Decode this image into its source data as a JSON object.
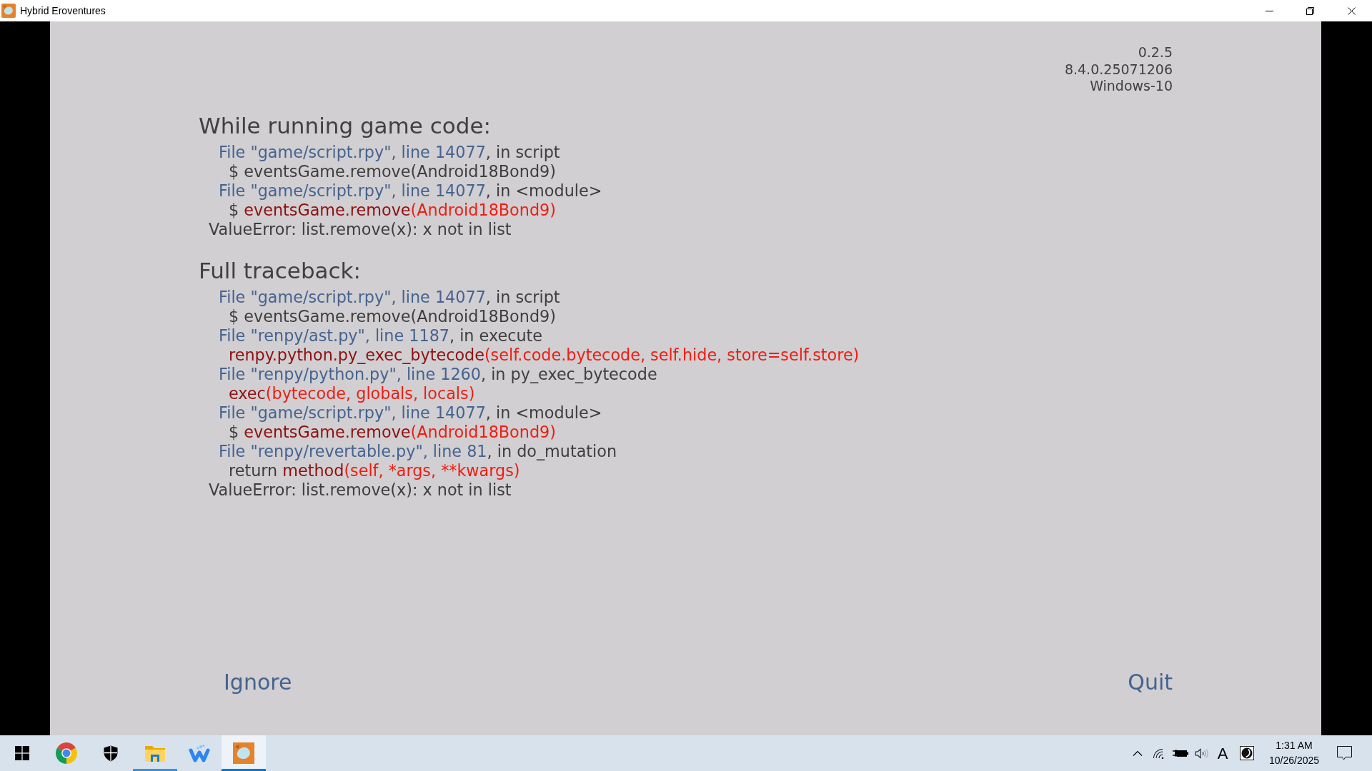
{
  "window": {
    "title": "Hybrid Eroventures"
  },
  "version_info": [
    "0.2.5",
    "8.4.0.25071206",
    "Windows-10"
  ],
  "sections": [
    {
      "heading": "While running game code:",
      "lines": [
        {
          "kind": "frame",
          "segments": [
            {
              "kind": "location",
              "text": "File \"game/script.rpy\", line 14077"
            },
            {
              "kind": "plain",
              "text": ", in script"
            }
          ]
        },
        {
          "kind": "source",
          "segments": [
            {
              "kind": "plain",
              "text": "$ eventsGame.remove(Android18Bond9)"
            }
          ]
        },
        {
          "kind": "frame",
          "segments": [
            {
              "kind": "location",
              "text": "File \"game/script.rpy\", line 14077"
            },
            {
              "kind": "plain",
              "text": ", in <module>"
            }
          ]
        },
        {
          "kind": "source",
          "segments": [
            {
              "kind": "plain",
              "text": "$ "
            },
            {
              "kind": "callee",
              "text": "eventsGame.remove"
            },
            {
              "kind": "arguments",
              "text": "(Android18Bond9)"
            }
          ]
        },
        {
          "kind": "exception",
          "segments": [
            {
              "kind": "plain",
              "text": "ValueError: list.remove(x): x not in list"
            }
          ]
        }
      ]
    },
    {
      "heading": "Full traceback:",
      "lines": [
        {
          "kind": "frame",
          "segments": [
            {
              "kind": "location",
              "text": "File \"game/script.rpy\", line 14077"
            },
            {
              "kind": "plain",
              "text": ", in script"
            }
          ]
        },
        {
          "kind": "source",
          "segments": [
            {
              "kind": "plain",
              "text": "$ eventsGame.remove(Android18Bond9)"
            }
          ]
        },
        {
          "kind": "frame",
          "segments": [
            {
              "kind": "location",
              "text": "File \"renpy/ast.py\", line 1187"
            },
            {
              "kind": "plain",
              "text": ", in execute"
            }
          ]
        },
        {
          "kind": "source",
          "segments": [
            {
              "kind": "callee",
              "text": "renpy.python.py_exec_bytecode"
            },
            {
              "kind": "arguments",
              "text": "(self.code.bytecode, self.hide, store=self.store)"
            }
          ]
        },
        {
          "kind": "frame",
          "segments": [
            {
              "kind": "location",
              "text": "File \"renpy/python.py\", line 1260"
            },
            {
              "kind": "plain",
              "text": ", in py_exec_bytecode"
            }
          ]
        },
        {
          "kind": "source",
          "segments": [
            {
              "kind": "callee",
              "text": "exec"
            },
            {
              "kind": "arguments",
              "text": "(bytecode, globals, locals)"
            }
          ]
        },
        {
          "kind": "frame",
          "segments": [
            {
              "kind": "location",
              "text": "File \"game/script.rpy\", line 14077"
            },
            {
              "kind": "plain",
              "text": ", in <module>"
            }
          ]
        },
        {
          "kind": "source",
          "segments": [
            {
              "kind": "plain",
              "text": "$ "
            },
            {
              "kind": "callee",
              "text": "eventsGame.remove"
            },
            {
              "kind": "arguments",
              "text": "(Android18Bond9)"
            }
          ]
        },
        {
          "kind": "frame",
          "segments": [
            {
              "kind": "location",
              "text": "File \"renpy/revertable.py\", line 81"
            },
            {
              "kind": "plain",
              "text": ", in do_mutation"
            }
          ]
        },
        {
          "kind": "source",
          "segments": [
            {
              "kind": "plain",
              "text": "return "
            },
            {
              "kind": "callee",
              "text": "method"
            },
            {
              "kind": "arguments",
              "text": "(self, *args, **kwargs)"
            }
          ]
        },
        {
          "kind": "exception",
          "segments": [
            {
              "kind": "plain",
              "text": "ValueError: list.remove(x): x not in list"
            }
          ]
        }
      ]
    }
  ],
  "actions": [
    "Ignore",
    "Quit"
  ],
  "taskbar": {
    "apps": [
      {
        "kind": "start",
        "running": false,
        "selected": false
      },
      {
        "kind": "chrome",
        "running": false,
        "selected": false
      },
      {
        "kind": "security",
        "running": false,
        "selected": false
      },
      {
        "kind": "explorer",
        "running": true,
        "selected": false
      },
      {
        "kind": "writer",
        "running": false,
        "selected": false
      },
      {
        "kind": "game",
        "running": true,
        "selected": true
      }
    ],
    "tray": {
      "input_indicator": "A",
      "time": "1:31 AM",
      "date": "10/26/2025"
    }
  }
}
